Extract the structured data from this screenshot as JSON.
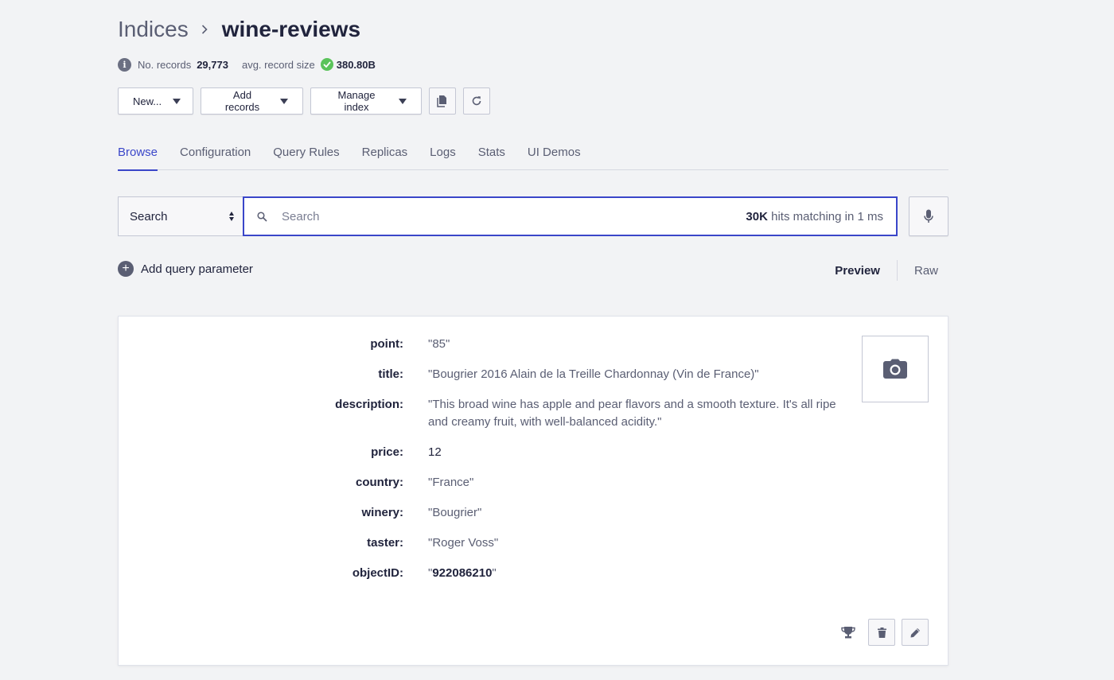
{
  "breadcrumb": {
    "root": "Indices",
    "current": "wine-reviews"
  },
  "meta": {
    "records_label": "No. records",
    "records_value": "29,773",
    "size_label": "avg. record size",
    "size_value": "380.80B"
  },
  "toolbar": {
    "new_label": "New...",
    "add_records_label": "Add records",
    "manage_index_label": "Manage index"
  },
  "tabs": [
    {
      "label": "Browse",
      "active": true
    },
    {
      "label": "Configuration"
    },
    {
      "label": "Query Rules"
    },
    {
      "label": "Replicas"
    },
    {
      "label": "Logs"
    },
    {
      "label": "Stats"
    },
    {
      "label": "UI Demos"
    }
  ],
  "search": {
    "mode": "Search",
    "placeholder": "Search",
    "hits_count": "30K",
    "hits_text": " hits matching in 1 ms"
  },
  "params": {
    "add_label": "Add query parameter",
    "preview_label": "Preview",
    "raw_label": "Raw"
  },
  "record": {
    "fields": [
      {
        "key": "point:",
        "value": "\"85\""
      },
      {
        "key": "title:",
        "value": "\"Bougrier 2016 Alain de la Treille Chardonnay (Vin de France)\""
      },
      {
        "key": "description:",
        "value": "\"This broad wine has apple and pear flavors and a smooth texture. It's all ripe and creamy fruit, with well-balanced acidity.\""
      },
      {
        "key": "price:",
        "value": "12"
      },
      {
        "key": "country:",
        "value": "\"France\""
      },
      {
        "key": "winery:",
        "value": "\"Bougrier\""
      },
      {
        "key": "taster:",
        "value": "\"Roger Voss\""
      }
    ],
    "object_id": {
      "key": "objectID:",
      "quote_open": "\"",
      "value": "922086210",
      "quote_close": "\""
    }
  },
  "icons": {
    "info": "info-icon",
    "check": "check-icon",
    "copy": "copy-icon",
    "refresh": "refresh-icon",
    "search": "search-icon",
    "mic": "microphone-icon",
    "plus": "plus-icon",
    "camera": "camera-icon",
    "trophy": "trophy-icon",
    "trash": "trash-icon",
    "pencil": "pencil-icon"
  },
  "colors": {
    "accent": "#3a46c9",
    "success": "#5ac35a",
    "background": "#f2f3f5"
  }
}
